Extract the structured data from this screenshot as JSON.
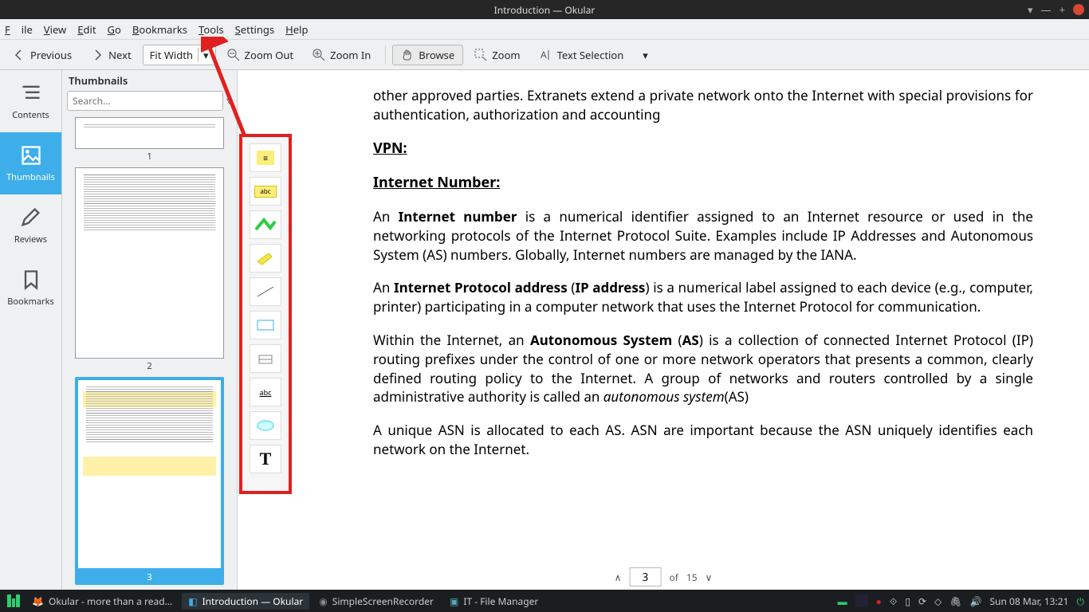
{
  "window": {
    "title": "Introduction  — Okular"
  },
  "menu": {
    "file": "File",
    "view": "View",
    "edit": "Edit",
    "go": "Go",
    "bookmarks": "Bookmarks",
    "tools": "Tools",
    "settings": "Settings",
    "help": "Help"
  },
  "toolbar": {
    "previous": "Previous",
    "next": "Next",
    "fit_width": "Fit Width",
    "zoom_out": "Zoom Out",
    "zoom_in": "Zoom In",
    "browse": "Browse",
    "zoom": "Zoom",
    "text_selection": "Text Selection"
  },
  "side": {
    "contents": "Contents",
    "thumbnails": "Thumbnails",
    "reviews": "Reviews",
    "bookmarks": "Bookmarks"
  },
  "thumbs": {
    "header": "Thumbnails",
    "search_placeholder": "Search...",
    "pages": [
      "1",
      "2",
      "3"
    ]
  },
  "doc": {
    "para_top": "other approved parties. Extranets extend a private network onto the Internet with special provisions for authentication, authorization and accounting",
    "vpn_h": "VPN:",
    "inetnum_h": "Internet Number:",
    "inetnum_p": "An Internet number is a numerical identifier assigned to an Internet resource or used in the networking protocols of the Internet Protocol Suite. Examples include IP Addresses and Autonomous System (AS) numbers. Globally, Internet numbers are managed by the IANA.",
    "ip_p": "An Internet Protocol address (IP address) is a numerical label assigned to each device (e.g., computer, printer) participating in a computer network that uses the Internet Protocol for communication.",
    "as_p": "Within the Internet, an Autonomous System (AS) is a collection of connected Internet Protocol (IP) routing prefixes under the control of one or more network operators that presents a common, clearly defined routing policy to the Internet. A group of networks and routers controlled by a single administrative authority is called an autonomous system(AS)",
    "asn_p": "A unique ASN is allocated to each AS. ASN are important because the ASN uniquely identifies each network on the Internet."
  },
  "nav": {
    "current": "3",
    "of": "of",
    "total": "15"
  },
  "taskbar": {
    "okular_site": "Okular - more than a read...",
    "okular_app": "Introduction  — Okular",
    "ssr": "SimpleScreenRecorder",
    "fm": "IT - File Manager",
    "clock": "Sun 08 Mar, 13:21"
  }
}
